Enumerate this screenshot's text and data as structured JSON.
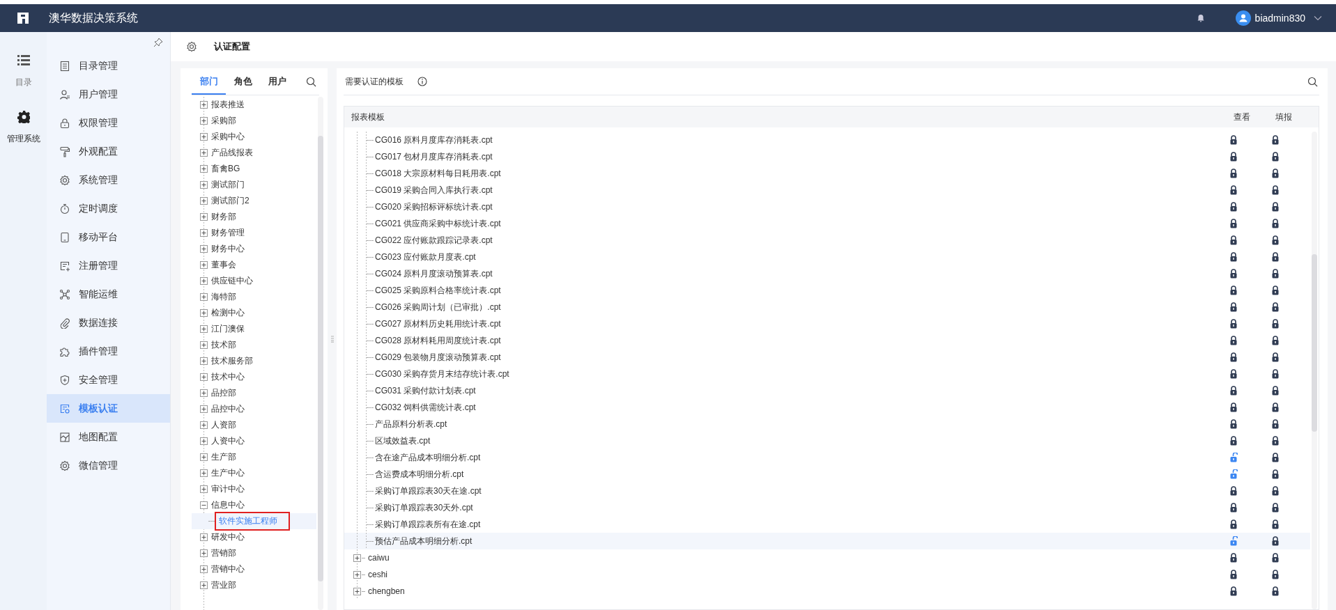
{
  "header": {
    "app_title": "澳华数据决策系统",
    "user": "biadmin830"
  },
  "rail": [
    {
      "label": "目录",
      "selected": false
    },
    {
      "label": "管理系统",
      "selected": true
    }
  ],
  "nav": [
    {
      "label": "目录管理",
      "selected": false
    },
    {
      "label": "用户管理",
      "selected": false
    },
    {
      "label": "权限管理",
      "selected": false
    },
    {
      "label": "外观配置",
      "selected": false
    },
    {
      "label": "系统管理",
      "selected": false
    },
    {
      "label": "定时调度",
      "selected": false
    },
    {
      "label": "移动平台",
      "selected": false
    },
    {
      "label": "注册管理",
      "selected": false
    },
    {
      "label": "智能运维",
      "selected": false
    },
    {
      "label": "数据连接",
      "selected": false
    },
    {
      "label": "插件管理",
      "selected": false
    },
    {
      "label": "安全管理",
      "selected": false
    },
    {
      "label": "模板认证",
      "selected": true
    },
    {
      "label": "地图配置",
      "selected": false
    },
    {
      "label": "微信管理",
      "selected": false
    }
  ],
  "page_title": "认证配置",
  "left_panel": {
    "tabs": [
      {
        "label": "部门",
        "selected": true
      },
      {
        "label": "角色",
        "selected": false
      },
      {
        "label": "用户",
        "selected": false
      }
    ],
    "tree": [
      {
        "label": "报表推送",
        "expanded": false,
        "selected": false
      },
      {
        "label": "采购部",
        "expanded": false,
        "selected": false
      },
      {
        "label": "采购中心",
        "expanded": false,
        "selected": false
      },
      {
        "label": "产品线报表",
        "expanded": false,
        "selected": false
      },
      {
        "label": "畜禽BG",
        "expanded": false,
        "selected": false
      },
      {
        "label": "测试部门",
        "expanded": false,
        "selected": false
      },
      {
        "label": "测试部门2",
        "expanded": false,
        "selected": false
      },
      {
        "label": "财务部",
        "expanded": false,
        "selected": false
      },
      {
        "label": "财务管理",
        "expanded": false,
        "selected": false
      },
      {
        "label": "财务中心",
        "expanded": false,
        "selected": false
      },
      {
        "label": "董事会",
        "expanded": false,
        "selected": false
      },
      {
        "label": "供应链中心",
        "expanded": false,
        "selected": false
      },
      {
        "label": "海特部",
        "expanded": false,
        "selected": false
      },
      {
        "label": "检测中心",
        "expanded": false,
        "selected": false
      },
      {
        "label": "江门澳保",
        "expanded": false,
        "selected": false
      },
      {
        "label": "技术部",
        "expanded": false,
        "selected": false
      },
      {
        "label": "技术服务部",
        "expanded": false,
        "selected": false
      },
      {
        "label": "技术中心",
        "expanded": false,
        "selected": false
      },
      {
        "label": "品控部",
        "expanded": false,
        "selected": false
      },
      {
        "label": "品控中心",
        "expanded": false,
        "selected": false
      },
      {
        "label": "人资部",
        "expanded": false,
        "selected": false
      },
      {
        "label": "人资中心",
        "expanded": false,
        "selected": false
      },
      {
        "label": "生产部",
        "expanded": false,
        "selected": false
      },
      {
        "label": "生产中心",
        "expanded": false,
        "selected": false
      },
      {
        "label": "审计中心",
        "expanded": false,
        "selected": false
      },
      {
        "label": "信息中心",
        "expanded": true,
        "selected": false,
        "children": [
          {
            "label": "软件实施工程师",
            "selected": true
          }
        ]
      },
      {
        "label": "研发中心",
        "expanded": false,
        "selected": false
      },
      {
        "label": "营销部",
        "expanded": false,
        "selected": false
      },
      {
        "label": "营销中心",
        "expanded": false,
        "selected": false
      },
      {
        "label": "营业部",
        "expanded": false,
        "selected": false
      }
    ]
  },
  "right_panel": {
    "title": "需要认证的模板",
    "columns": [
      "报表模板",
      "查看",
      "填报"
    ],
    "rows": [
      {
        "kind": "file",
        "name": "CG016 原料月度库存消耗表.cpt",
        "view_locked": true,
        "fill_locked": true,
        "selected": false
      },
      {
        "kind": "file",
        "name": "CG017 包材月度库存消耗表.cpt",
        "view_locked": true,
        "fill_locked": true,
        "selected": false
      },
      {
        "kind": "file",
        "name": "CG018 大宗原材料每日耗用表.cpt",
        "view_locked": true,
        "fill_locked": true,
        "selected": false
      },
      {
        "kind": "file",
        "name": "CG019 采购合同入库执行表.cpt",
        "view_locked": true,
        "fill_locked": true,
        "selected": false
      },
      {
        "kind": "file",
        "name": "CG020 采购招标评标统计表.cpt",
        "view_locked": true,
        "fill_locked": true,
        "selected": false
      },
      {
        "kind": "file",
        "name": "CG021 供应商采购中标统计表.cpt",
        "view_locked": true,
        "fill_locked": true,
        "selected": false
      },
      {
        "kind": "file",
        "name": "CG022 应付账款跟踪记录表.cpt",
        "view_locked": true,
        "fill_locked": true,
        "selected": false
      },
      {
        "kind": "file",
        "name": "CG023 应付账款月度表.cpt",
        "view_locked": true,
        "fill_locked": true,
        "selected": false
      },
      {
        "kind": "file",
        "name": "CG024 原料月度滚动预算表.cpt",
        "view_locked": true,
        "fill_locked": true,
        "selected": false
      },
      {
        "kind": "file",
        "name": "CG025 采购原料合格率统计表.cpt",
        "view_locked": true,
        "fill_locked": true,
        "selected": false
      },
      {
        "kind": "file",
        "name": "CG026 采购周计划（已审批）.cpt",
        "view_locked": true,
        "fill_locked": true,
        "selected": false
      },
      {
        "kind": "file",
        "name": "CG027 原材料历史耗用统计表.cpt",
        "view_locked": true,
        "fill_locked": true,
        "selected": false
      },
      {
        "kind": "file",
        "name": "CG028 原材料耗用周度统计表.cpt",
        "view_locked": true,
        "fill_locked": true,
        "selected": false
      },
      {
        "kind": "file",
        "name": "CG029 包装物月度滚动预算表.cpt",
        "view_locked": true,
        "fill_locked": true,
        "selected": false
      },
      {
        "kind": "file",
        "name": "CG030 采购存货月末结存统计表.cpt",
        "view_locked": true,
        "fill_locked": true,
        "selected": false
      },
      {
        "kind": "file",
        "name": "CG031 采购付款计划表.cpt",
        "view_locked": true,
        "fill_locked": true,
        "selected": false
      },
      {
        "kind": "file",
        "name": "CG032 饲料供需统计表.cpt",
        "view_locked": true,
        "fill_locked": true,
        "selected": false
      },
      {
        "kind": "file",
        "name": "产品原料分析表.cpt",
        "view_locked": true,
        "fill_locked": true,
        "selected": false
      },
      {
        "kind": "file",
        "name": "区域效益表.cpt",
        "view_locked": true,
        "fill_locked": true,
        "selected": false
      },
      {
        "kind": "file",
        "name": "含在途产品成本明细分析.cpt",
        "view_locked": false,
        "fill_locked": true,
        "selected": false
      },
      {
        "kind": "file",
        "name": "含运费成本明细分析.cpt",
        "view_locked": false,
        "fill_locked": true,
        "selected": false
      },
      {
        "kind": "file",
        "name": "采购订单跟踪表30天在途.cpt",
        "view_locked": true,
        "fill_locked": true,
        "selected": false
      },
      {
        "kind": "file",
        "name": "采购订单跟踪表30天外.cpt",
        "view_locked": true,
        "fill_locked": true,
        "selected": false
      },
      {
        "kind": "file",
        "name": "采购订单跟踪表所有在途.cpt",
        "view_locked": true,
        "fill_locked": true,
        "selected": false
      },
      {
        "kind": "file",
        "name": "预估产品成本明细分析.cpt",
        "view_locked": false,
        "fill_locked": true,
        "selected": true
      },
      {
        "kind": "folder",
        "name": "caiwu",
        "view_locked": true,
        "fill_locked": true,
        "selected": false
      },
      {
        "kind": "folder",
        "name": "ceshi",
        "view_locked": true,
        "fill_locked": true,
        "selected": false
      },
      {
        "kind": "folder",
        "name": "chengben",
        "view_locked": true,
        "fill_locked": true,
        "selected": false
      }
    ]
  }
}
